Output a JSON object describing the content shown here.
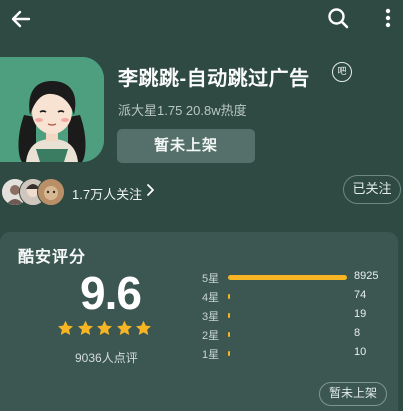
{
  "app": {
    "title": "李跳跳-自动跳过广告",
    "badge": "吧",
    "meta": "派大星1.75  20.8w热度",
    "install_label": "暂未上架"
  },
  "social": {
    "followers_text": "1.7万人关注",
    "follow_status": "已关注"
  },
  "rating": {
    "title": "酷安评分",
    "score": "9.6",
    "stars": 5,
    "count_text": "9036人点评",
    "breakdown": [
      {
        "label": "5星",
        "count": "8925",
        "fraction": 0.988
      },
      {
        "label": "4星",
        "count": "74",
        "fraction": 0.008
      },
      {
        "label": "3星",
        "count": "19",
        "fraction": 0.002
      },
      {
        "label": "2星",
        "count": "8",
        "fraction": 0.001
      },
      {
        "label": "1星",
        "count": "10",
        "fraction": 0.001
      }
    ],
    "status_button": "暂未上架"
  },
  "icons": {
    "back": "back-arrow-icon",
    "search": "search-icon",
    "more": "more-vertical-icon",
    "chevron": "chevron-right-icon",
    "star": "star-icon"
  },
  "colors": {
    "background": "#2f4943",
    "card": "#3c5752",
    "star": "#f7b523",
    "bar": "#f7b523"
  }
}
